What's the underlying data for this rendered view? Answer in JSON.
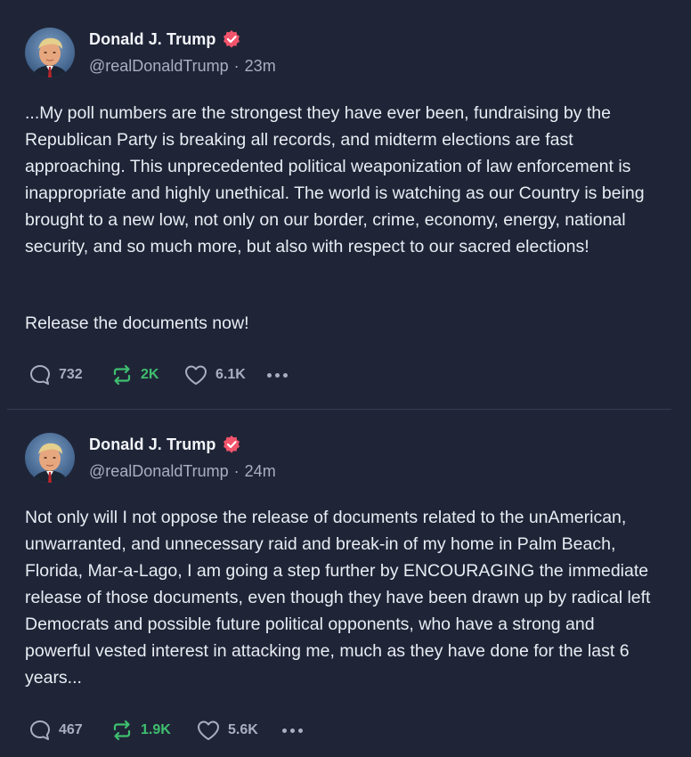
{
  "posts": [
    {
      "author": {
        "name": "Donald J. Trump",
        "handle": "@realDonaldTrump",
        "verified": true
      },
      "time": "23m",
      "separator": "·",
      "paragraphs": [
        "...My poll numbers are the strongest they have ever been, fundraising by the Republican Party is breaking all records, and midterm elections are fast approaching. This unprecedented political weaponization of law enforcement is inappropriate and highly unethical. The world is watching as our Country is being brought to a new low, not only on our border, crime, economy, energy, national security, and so much more, but also with respect to our sacred elections!",
        "Release the documents now!"
      ],
      "stats": {
        "replies": "732",
        "reposts": "2K",
        "likes": "6.1K"
      }
    },
    {
      "author": {
        "name": "Donald J. Trump",
        "handle": "@realDonaldTrump",
        "verified": true
      },
      "time": "24m",
      "separator": "·",
      "paragraphs": [
        "Not only will I not oppose the release of documents related to the unAmerican, unwarranted, and unnecessary raid and break-in of my home in Palm Beach, Florida, Mar-a-Lago, I am going a step further by ENCOURAGING the immediate release of those documents, even though they have been drawn up by radical left Democrats and possible future political opponents, who have a strong and powerful vested interest in attacking me, much as they have done for the last 6 years..."
      ],
      "stats": {
        "replies": "467",
        "reposts": "1.9K",
        "likes": "5.6K"
      }
    }
  ],
  "icons": {
    "reply": "reply-icon",
    "repost": "repost-icon",
    "like": "heart-icon",
    "more": "more-icon",
    "verified": "verified-badge-icon"
  },
  "colors": {
    "background": "#1f2537",
    "text": "#e9ecf3",
    "muted": "#a9afbf",
    "repost_active": "#3fbf6f",
    "verified": "#f2546b"
  }
}
